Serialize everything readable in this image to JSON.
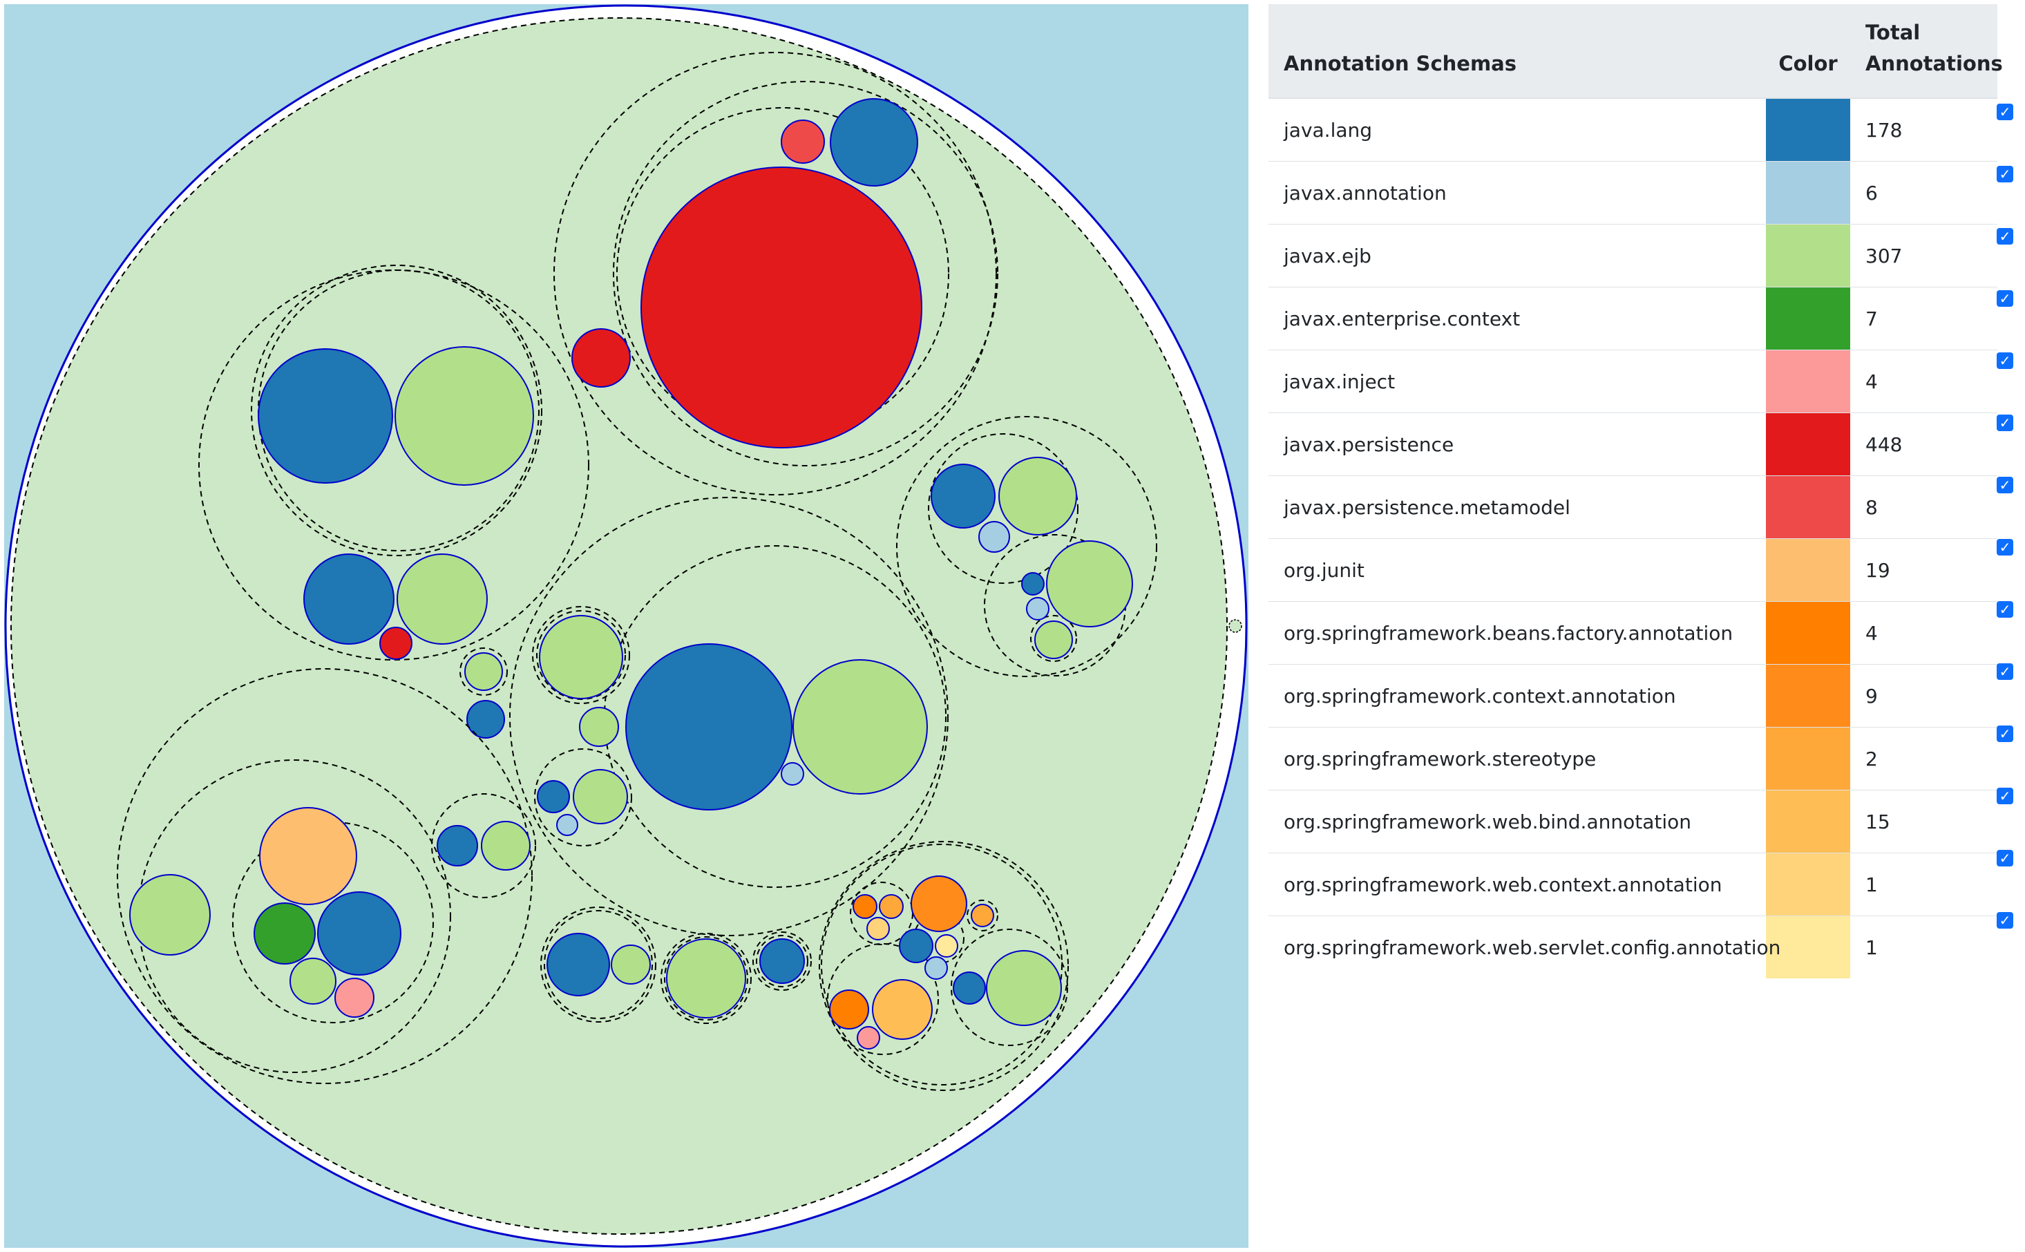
{
  "legend": {
    "headers": {
      "schemas": "Annotation Schemas",
      "color": "Color",
      "total": "Total Annotations"
    },
    "rows": [
      {
        "name": "java.lang",
        "color": "#1f77b4",
        "total": "178",
        "checked": true
      },
      {
        "name": "javax.annotation",
        "color": "#a6cee3",
        "total": "6",
        "checked": true
      },
      {
        "name": "javax.ejb",
        "color": "#b2df8a",
        "total": "307",
        "checked": true
      },
      {
        "name": "javax.enterprise.context",
        "color": "#33a02c",
        "total": "7",
        "checked": true
      },
      {
        "name": "javax.inject",
        "color": "#fb9a99",
        "total": "4",
        "checked": true
      },
      {
        "name": "javax.persistence",
        "color": "#e31a1c",
        "total": "448",
        "checked": true
      },
      {
        "name": "javax.persistence.metamodel",
        "color": "#ef4a4a",
        "total": "8",
        "checked": true
      },
      {
        "name": "org.junit",
        "color": "#fdbf6f",
        "total": "19",
        "checked": true
      },
      {
        "name": "org.springframework.beans.factory.annotation",
        "color": "#ff7f00",
        "total": "4",
        "checked": true
      },
      {
        "name": "org.springframework.context.annotation",
        "color": "#ff8c1a",
        "total": "9",
        "checked": true
      },
      {
        "name": "org.springframework.stereotype",
        "color": "#ffa83a",
        "total": "2",
        "checked": true
      },
      {
        "name": "org.springframework.web.bind.annotation",
        "color": "#ffbe55",
        "total": "15",
        "checked": true
      },
      {
        "name": "org.springframework.web.context.annotation",
        "color": "#ffd37a",
        "total": "1",
        "checked": true
      },
      {
        "name": "org.springframework.web.servlet.config.annotation",
        "color": "#ffe99a",
        "total": "1",
        "checked": true
      }
    ]
  },
  "visualization": {
    "background": "#add8e6",
    "root_fill": "#cce8c6",
    "stroke": "#0000cc"
  }
}
